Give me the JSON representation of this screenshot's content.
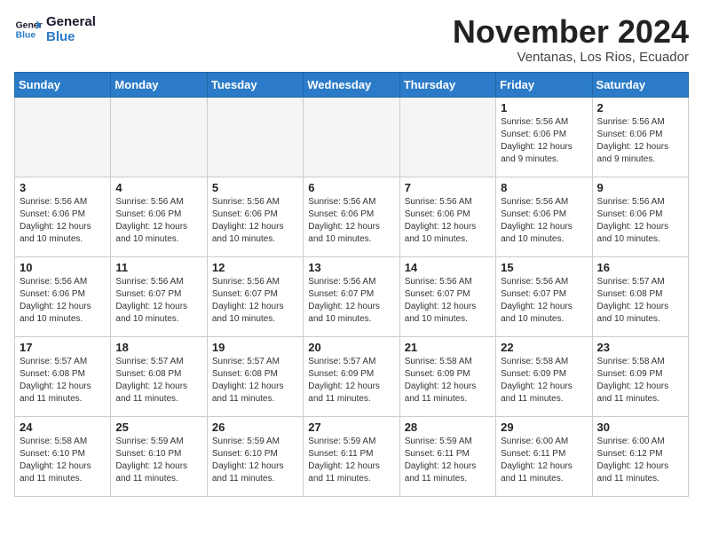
{
  "header": {
    "logo_line1": "General",
    "logo_line2": "Blue",
    "month_title": "November 2024",
    "location": "Ventanas, Los Rios, Ecuador"
  },
  "weekdays": [
    "Sunday",
    "Monday",
    "Tuesday",
    "Wednesday",
    "Thursday",
    "Friday",
    "Saturday"
  ],
  "weeks": [
    [
      {
        "day": "",
        "info": ""
      },
      {
        "day": "",
        "info": ""
      },
      {
        "day": "",
        "info": ""
      },
      {
        "day": "",
        "info": ""
      },
      {
        "day": "",
        "info": ""
      },
      {
        "day": "1",
        "info": "Sunrise: 5:56 AM\nSunset: 6:06 PM\nDaylight: 12 hours\nand 9 minutes."
      },
      {
        "day": "2",
        "info": "Sunrise: 5:56 AM\nSunset: 6:06 PM\nDaylight: 12 hours\nand 9 minutes."
      }
    ],
    [
      {
        "day": "3",
        "info": "Sunrise: 5:56 AM\nSunset: 6:06 PM\nDaylight: 12 hours\nand 10 minutes."
      },
      {
        "day": "4",
        "info": "Sunrise: 5:56 AM\nSunset: 6:06 PM\nDaylight: 12 hours\nand 10 minutes."
      },
      {
        "day": "5",
        "info": "Sunrise: 5:56 AM\nSunset: 6:06 PM\nDaylight: 12 hours\nand 10 minutes."
      },
      {
        "day": "6",
        "info": "Sunrise: 5:56 AM\nSunset: 6:06 PM\nDaylight: 12 hours\nand 10 minutes."
      },
      {
        "day": "7",
        "info": "Sunrise: 5:56 AM\nSunset: 6:06 PM\nDaylight: 12 hours\nand 10 minutes."
      },
      {
        "day": "8",
        "info": "Sunrise: 5:56 AM\nSunset: 6:06 PM\nDaylight: 12 hours\nand 10 minutes."
      },
      {
        "day": "9",
        "info": "Sunrise: 5:56 AM\nSunset: 6:06 PM\nDaylight: 12 hours\nand 10 minutes."
      }
    ],
    [
      {
        "day": "10",
        "info": "Sunrise: 5:56 AM\nSunset: 6:06 PM\nDaylight: 12 hours\nand 10 minutes."
      },
      {
        "day": "11",
        "info": "Sunrise: 5:56 AM\nSunset: 6:07 PM\nDaylight: 12 hours\nand 10 minutes."
      },
      {
        "day": "12",
        "info": "Sunrise: 5:56 AM\nSunset: 6:07 PM\nDaylight: 12 hours\nand 10 minutes."
      },
      {
        "day": "13",
        "info": "Sunrise: 5:56 AM\nSunset: 6:07 PM\nDaylight: 12 hours\nand 10 minutes."
      },
      {
        "day": "14",
        "info": "Sunrise: 5:56 AM\nSunset: 6:07 PM\nDaylight: 12 hours\nand 10 minutes."
      },
      {
        "day": "15",
        "info": "Sunrise: 5:56 AM\nSunset: 6:07 PM\nDaylight: 12 hours\nand 10 minutes."
      },
      {
        "day": "16",
        "info": "Sunrise: 5:57 AM\nSunset: 6:08 PM\nDaylight: 12 hours\nand 10 minutes."
      }
    ],
    [
      {
        "day": "17",
        "info": "Sunrise: 5:57 AM\nSunset: 6:08 PM\nDaylight: 12 hours\nand 11 minutes."
      },
      {
        "day": "18",
        "info": "Sunrise: 5:57 AM\nSunset: 6:08 PM\nDaylight: 12 hours\nand 11 minutes."
      },
      {
        "day": "19",
        "info": "Sunrise: 5:57 AM\nSunset: 6:08 PM\nDaylight: 12 hours\nand 11 minutes."
      },
      {
        "day": "20",
        "info": "Sunrise: 5:57 AM\nSunset: 6:09 PM\nDaylight: 12 hours\nand 11 minutes."
      },
      {
        "day": "21",
        "info": "Sunrise: 5:58 AM\nSunset: 6:09 PM\nDaylight: 12 hours\nand 11 minutes."
      },
      {
        "day": "22",
        "info": "Sunrise: 5:58 AM\nSunset: 6:09 PM\nDaylight: 12 hours\nand 11 minutes."
      },
      {
        "day": "23",
        "info": "Sunrise: 5:58 AM\nSunset: 6:09 PM\nDaylight: 12 hours\nand 11 minutes."
      }
    ],
    [
      {
        "day": "24",
        "info": "Sunrise: 5:58 AM\nSunset: 6:10 PM\nDaylight: 12 hours\nand 11 minutes."
      },
      {
        "day": "25",
        "info": "Sunrise: 5:59 AM\nSunset: 6:10 PM\nDaylight: 12 hours\nand 11 minutes."
      },
      {
        "day": "26",
        "info": "Sunrise: 5:59 AM\nSunset: 6:10 PM\nDaylight: 12 hours\nand 11 minutes."
      },
      {
        "day": "27",
        "info": "Sunrise: 5:59 AM\nSunset: 6:11 PM\nDaylight: 12 hours\nand 11 minutes."
      },
      {
        "day": "28",
        "info": "Sunrise: 5:59 AM\nSunset: 6:11 PM\nDaylight: 12 hours\nand 11 minutes."
      },
      {
        "day": "29",
        "info": "Sunrise: 6:00 AM\nSunset: 6:11 PM\nDaylight: 12 hours\nand 11 minutes."
      },
      {
        "day": "30",
        "info": "Sunrise: 6:00 AM\nSunset: 6:12 PM\nDaylight: 12 hours\nand 11 minutes."
      }
    ]
  ]
}
